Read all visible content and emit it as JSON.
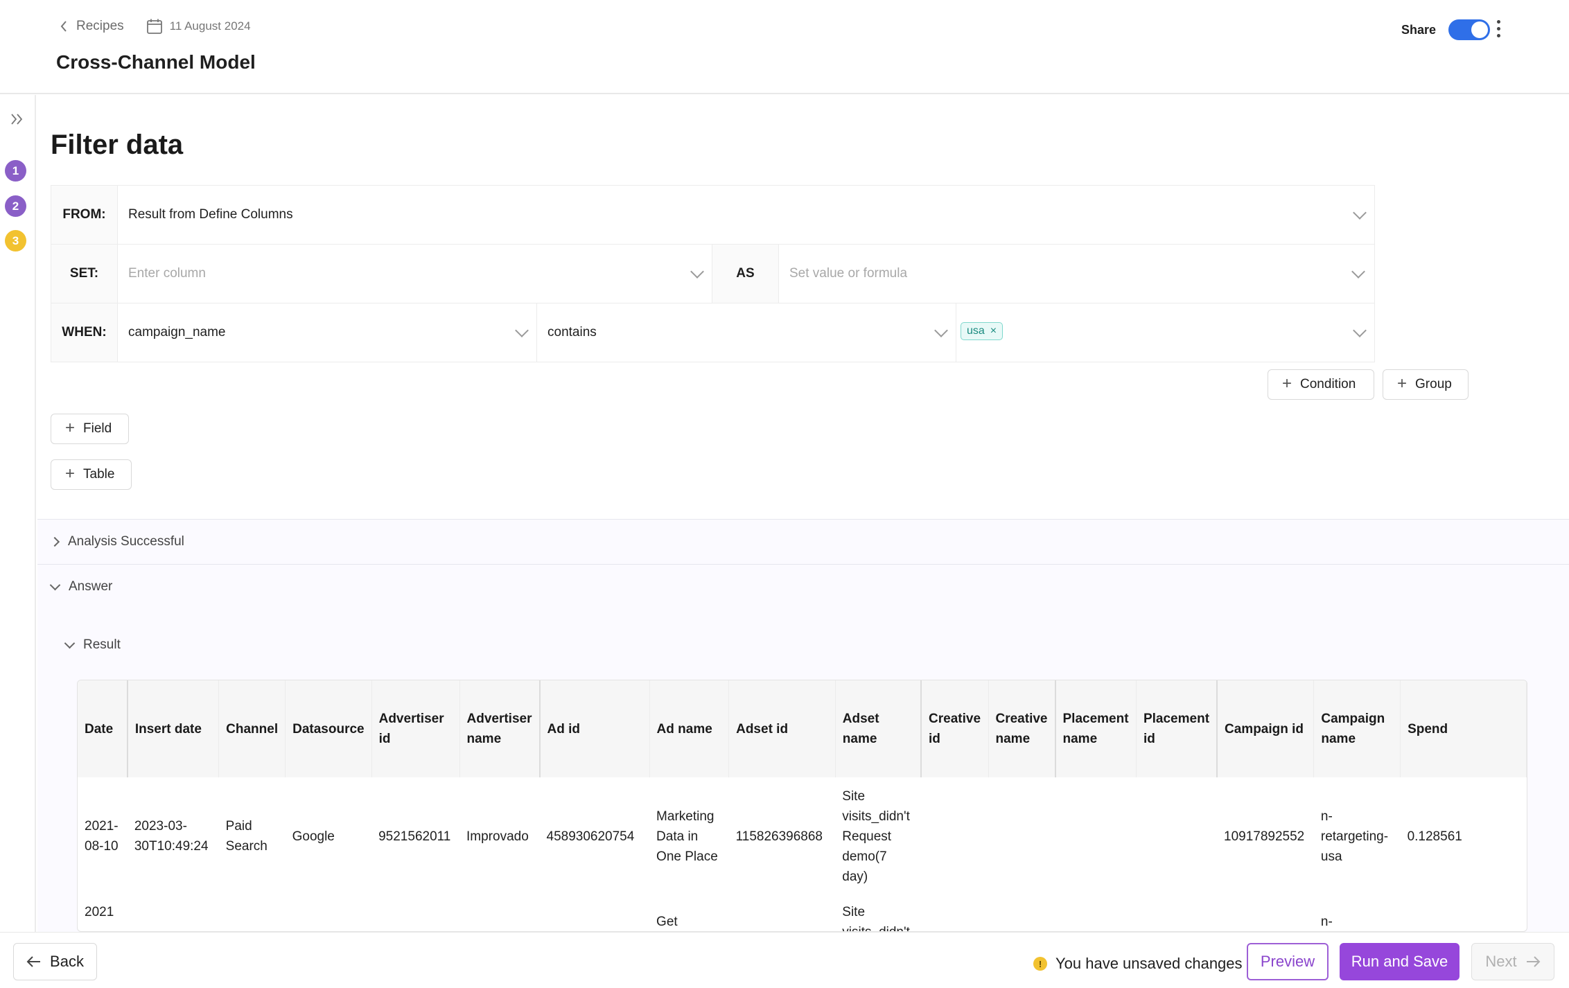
{
  "header": {
    "back_label": "Recipes",
    "date": "11 August 2024",
    "title": "Cross-Channel Model",
    "share_label": "Share",
    "share_enabled": true
  },
  "steps": [
    "1",
    "2",
    "3"
  ],
  "filter": {
    "title": "Filter data",
    "from_label": "FROM:",
    "from_value": "Result from Define Columns",
    "set_label": "SET:",
    "set_placeholder": "Enter column",
    "as_label": "AS",
    "as_placeholder": "Set value or formula",
    "when_label": "WHEN:",
    "when_column": "campaign_name",
    "when_operator": "contains",
    "when_tag": "usa",
    "tag_close": "×"
  },
  "buttons": {
    "condition": "Condition",
    "group": "Group",
    "field": "Field",
    "table": "Table"
  },
  "sections": {
    "analysis": "Analysis Successful",
    "answer": "Answer",
    "result": "Result"
  },
  "table": {
    "headers": [
      "Date",
      "Insert date",
      "Channel",
      "Datasource",
      "Advertiser id",
      "Advertiser name",
      "Ad id",
      "Ad name",
      "Adset id",
      "Adset name",
      "Creative id",
      "Creative name",
      "Placement name",
      "Placement id",
      "Campaign id",
      "Campaign name",
      "Spend"
    ],
    "rows": [
      [
        "2021-08-10",
        "2023-03-30T10:49:24",
        "Paid Search",
        "Google",
        "9521562011",
        "Improvado",
        "458930620754",
        "Marketing Data in One Place",
        "115826396868",
        "Site visits_didn't Request demo(7 day)",
        "",
        "",
        "",
        "",
        "10917892552",
        "n-retargeting-usa",
        "0.128561"
      ],
      [
        "2021",
        "",
        "",
        "",
        "",
        "",
        "",
        "Get",
        "",
        "Site visits_didn't",
        "",
        "",
        "",
        "",
        "",
        "n-",
        ""
      ]
    ]
  },
  "footer": {
    "back": "Back",
    "unsaved": "You have unsaved changes",
    "warn_symbol": "!",
    "preview": "Preview",
    "run_save": "Run and Save",
    "next": "Next"
  },
  "colors": {
    "accent": "#9647db",
    "toggle": "#2f6fe8",
    "step_done": "#8a5fc7",
    "step_current": "#f2c230",
    "tag": "#1a8b7f"
  }
}
